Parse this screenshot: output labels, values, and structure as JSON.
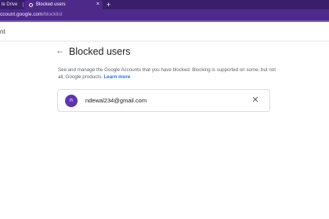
{
  "browser": {
    "tabs": [
      {
        "label": "le Drive",
        "active": false
      },
      {
        "label": "Blocked users",
        "active": true
      }
    ],
    "close_glyph": "×",
    "new_tab_glyph": "+",
    "url_host": "ccount.google.com",
    "url_path": "/blocklist"
  },
  "page": {
    "brand_fragment": "nt",
    "back_icon": "arrow-left-icon",
    "back_glyph": "←",
    "title": "Blocked users",
    "description": "See and manage the Google Accounts that you have blocked. Blocking is supported on some, but not all, Google products.",
    "learn_more": "Learn more"
  },
  "blocked_users": [
    {
      "initial": "n",
      "email": "ndewal234@gmail.com",
      "remove_glyph": "✕"
    }
  ],
  "colors": {
    "browser_frame": "#3b1e6b",
    "avatar": "#5e35b1",
    "link": "#1a73e8"
  }
}
